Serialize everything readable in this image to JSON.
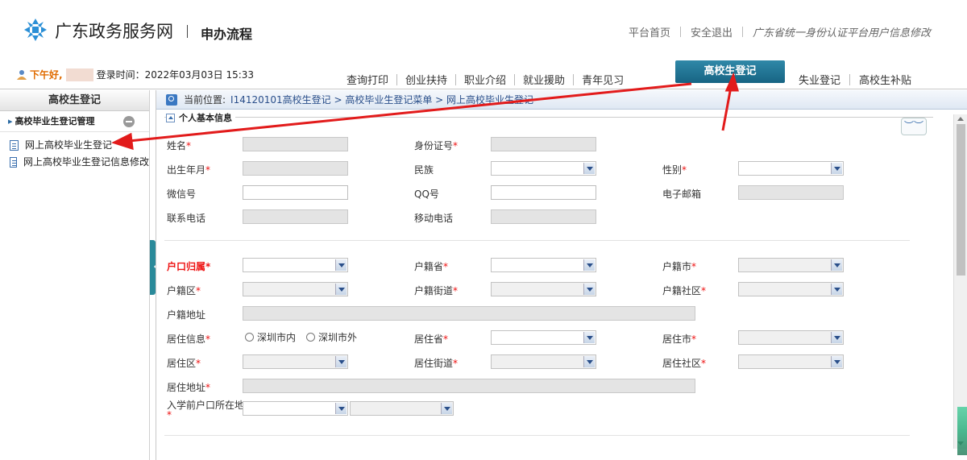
{
  "header": {
    "site_name": "广东政务服务网",
    "page_title": "申办流程",
    "links": [
      "平台首页",
      "安全退出",
      "广东省统一身份认证平台用户信息修改"
    ]
  },
  "greeting": {
    "hello": "下午好,",
    "login_time": "登录时间：2022年03月03日 15:33"
  },
  "nav": {
    "items": [
      "查询打印",
      "创业扶持",
      "职业介绍",
      "就业援助",
      "青年见习"
    ],
    "active": "高校生登记",
    "right_items": [
      "失业登记",
      "高校生补贴"
    ]
  },
  "sidebar": {
    "title": "高校生登记",
    "group": "高校毕业生登记管理",
    "items": [
      "网上高校毕业生登记",
      "网上高校毕业生登记信息修改"
    ]
  },
  "breadcrumb": {
    "label": "当前位置:",
    "path": "I14120101高校生登记 > 高校毕业生登记菜单 > 网上高校毕业生登记"
  },
  "section": {
    "title": "个人基本信息"
  },
  "form": {
    "name": "姓名",
    "id_number": "身份证号",
    "birth": "出生年月",
    "ethnicity": "民族",
    "gender": "性别",
    "wechat": "微信号",
    "qq": "QQ号",
    "email": "电子邮箱",
    "phone": "联系电话",
    "mobile": "移动电话",
    "hukou": "户口归属",
    "hj_province": "户籍省",
    "hj_city": "户籍市",
    "hj_district": "户籍区",
    "hj_street": "户籍街道",
    "hj_community": "户籍社区",
    "hj_address": "户籍地址",
    "residence_info": "居住信息",
    "radio_in": "深圳市内",
    "radio_out": "深圳市外",
    "jz_province": "居住省",
    "jz_city": "居住市",
    "jz_district": "居住区",
    "jz_street": "居住街道",
    "jz_community": "居住社区",
    "jz_address": "居住地址",
    "pre_school": "入学前户口所在地",
    "required_mark": "*"
  },
  "colors": {
    "accent": "#1f7594",
    "annotation_arrow": "#e21b1b"
  }
}
